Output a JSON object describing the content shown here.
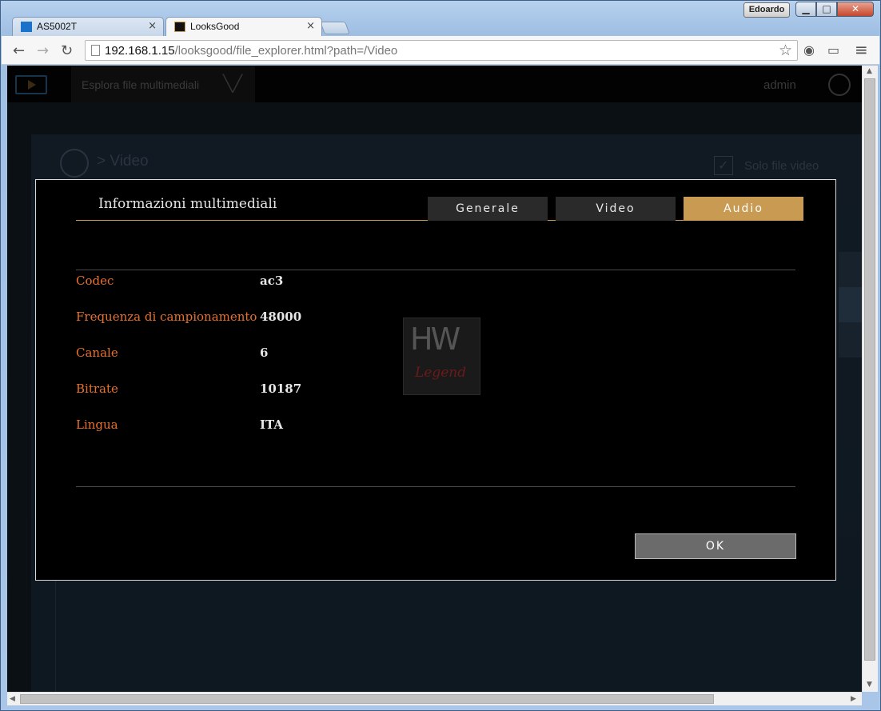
{
  "window": {
    "user_badge": "Edoardo",
    "min": "▁",
    "max": "□",
    "close": "✕"
  },
  "tabs": [
    {
      "title": "AS5002T",
      "close": "×"
    },
    {
      "title": "LooksGood",
      "close": "×"
    }
  ],
  "toolbar": {
    "back": "←",
    "forward": "→",
    "reload": "↻",
    "url_host": "192.168.1.15",
    "url_path": "/looksgood/file_explorer.html?path=/Video",
    "star": "☆",
    "extension": "◉",
    "cast": "▭",
    "menu": "≡"
  },
  "app": {
    "nav_label": "Esplora file multimediali",
    "nav_chevron": "╲╱",
    "user": "admin",
    "breadcrumb": "> Video",
    "video_only_label": "Solo file video",
    "check_mark": "✓"
  },
  "modal": {
    "title": "Informazioni multimediali",
    "tabs": [
      {
        "label": "Generale"
      },
      {
        "label": "Video"
      },
      {
        "label": "Audio"
      }
    ],
    "active_tab": "Audio",
    "rows": [
      {
        "key": "Codec",
        "value": "ac3"
      },
      {
        "key": "Frequenza di campionamento",
        "value": "48000"
      },
      {
        "key": "Canale",
        "value": "6"
      },
      {
        "key": "Bitrate",
        "value": "10187"
      },
      {
        "key": "Lingua",
        "value": "ITA"
      }
    ],
    "ok_label": "OK",
    "watermark_top": "HW",
    "watermark_bottom": "Legend"
  },
  "colors": {
    "accent": "#c99a52",
    "key_text": "#e8702a"
  }
}
